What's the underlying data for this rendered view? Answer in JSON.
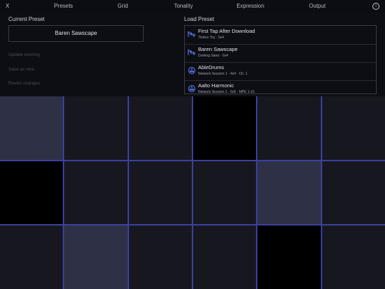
{
  "topbar": {
    "close_label": "X",
    "tabs": [
      {
        "label": "Presets",
        "active": true
      },
      {
        "label": "Grid",
        "active": false
      },
      {
        "label": "Tonality",
        "active": false
      },
      {
        "label": "Expression",
        "active": false
      },
      {
        "label": "Output",
        "active": false
      }
    ],
    "info_label": "i"
  },
  "current_preset": {
    "title": "Current Preset",
    "value": "Baren Sawscape",
    "actions": [
      "Update existing",
      "Save as new",
      "Revert changes"
    ]
  },
  "load_preset": {
    "title": "Load Preset",
    "items": [
      {
        "name": "First Tap After Download",
        "subtitle": "Timbre Toy · 5x4",
        "icon": "waveform-icon"
      },
      {
        "name": "Baren Sawscape",
        "subtitle": "Dueling Saws · 6x4",
        "icon": "waveform-icon"
      },
      {
        "name": "AbleDrums",
        "subtitle": "Network Session 1 · 4x4 · Ch. 1",
        "icon": "midi-port-icon"
      },
      {
        "name": "Aalto Harmonic",
        "subtitle": "Network Session 1 · 6x6 · MPE 1-16",
        "icon": "midi-port-icon"
      }
    ]
  },
  "grid": {
    "rows": 3,
    "cols": 6,
    "cells": [
      "#2e3146",
      "#17181f",
      "#17181f",
      "#000000",
      "#17181f",
      "#17181f",
      "#000000",
      "#17181f",
      "#17181f",
      "#17181f",
      "#2e3146",
      "#17181f",
      "#17181f",
      "#2e3146",
      "#17181f",
      "#17181f",
      "#000000",
      "#17181f"
    ]
  },
  "colors": {
    "accent": "#e6d84e",
    "grid_line": "#3c40a0",
    "icon": "#4f6cd8"
  }
}
